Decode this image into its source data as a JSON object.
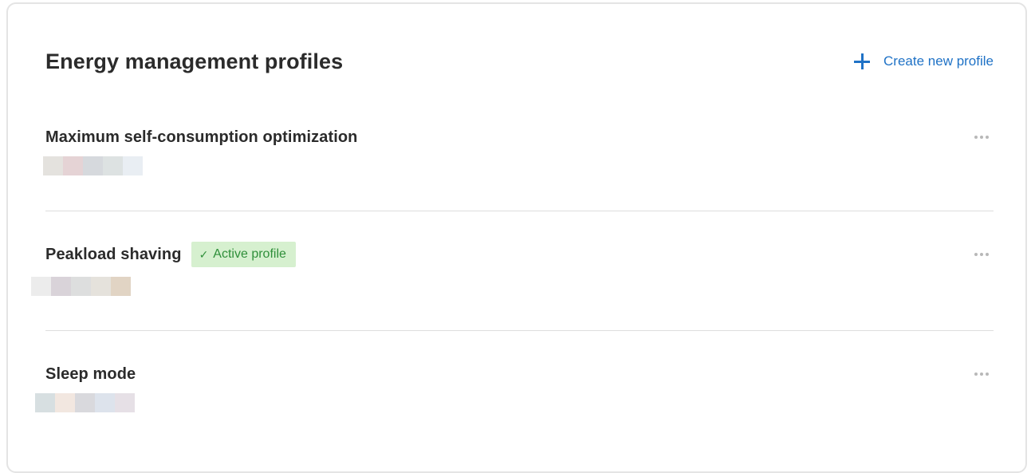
{
  "header": {
    "title": "Energy management profiles",
    "create_label": "Create new profile"
  },
  "profiles": [
    {
      "name": "Maximum self-consumption optimization",
      "active": false,
      "badge_label": "",
      "redacted_swatches": [
        "#e4e2de",
        "#e5d3d5",
        "#d6d9dd",
        "#dde2e2",
        "#e9eef3"
      ]
    },
    {
      "name": "Peakload shaving",
      "active": true,
      "badge_label": "Active profile",
      "redacted_swatches": [
        "#ececec",
        "#d9d3d9",
        "#dddede",
        "#e5e2dc",
        "#e1d4c4"
      ]
    },
    {
      "name": "Sleep mode",
      "active": false,
      "badge_label": "",
      "redacted_swatches": [
        "#d7dfe1",
        "#f2e7e0",
        "#d9d9dd",
        "#dde3ec",
        "#e6e0e6"
      ]
    }
  ],
  "colors": {
    "accent": "#1f72c6",
    "active_badge_bg": "#d6f0cf",
    "active_badge_text": "#2f8f3a",
    "divider": "#dedede"
  },
  "icons": {
    "create": "plus-icon",
    "badge": "check-icon",
    "menu": "more-horizontal-icon"
  }
}
